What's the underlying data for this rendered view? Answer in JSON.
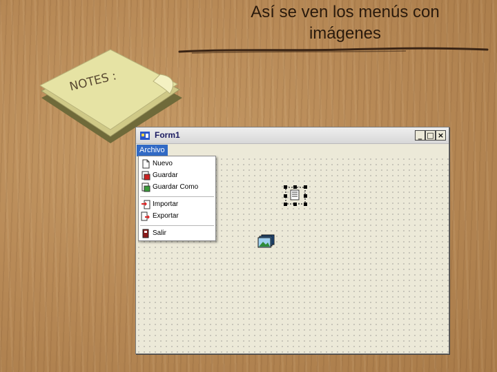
{
  "slide": {
    "title_line1": "Así se ven los menús con",
    "title_line2": "imágenes"
  },
  "notes": {
    "label": "NOTES :",
    "color": "#e6e3a4"
  },
  "form": {
    "title": "Form1",
    "buttons": {
      "minimize": "_",
      "maximize": "□",
      "close": "×"
    }
  },
  "menubar": {
    "archivo": "Archivo"
  },
  "menu": {
    "items": [
      {
        "label": "Nuevo",
        "icon": "new-file-icon"
      },
      {
        "label": "Guardar",
        "icon": "save-icon"
      },
      {
        "label": "Guardar Como",
        "icon": "save-as-icon"
      },
      {
        "label": "Importar",
        "icon": "import-icon"
      },
      {
        "label": "Exportar",
        "icon": "export-icon"
      },
      {
        "label": "Salir",
        "icon": "exit-icon"
      }
    ]
  },
  "colors": {
    "menu_highlight": "#316ac5",
    "form_background": "#ece9d8",
    "wood": "#b88a57"
  }
}
